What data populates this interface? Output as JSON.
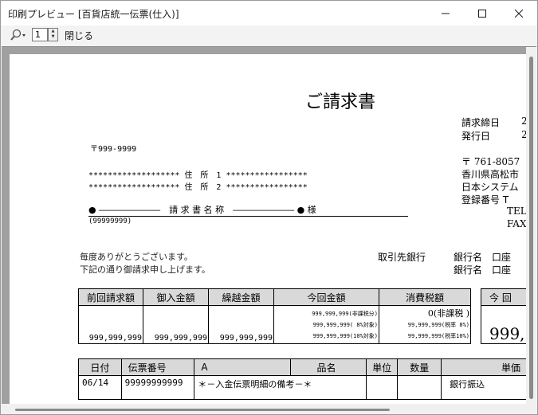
{
  "window": {
    "title": "印刷プレビュー [百貨店統一伝票(仕入)]"
  },
  "toolbar": {
    "page_value": "1",
    "close_label": "閉じる",
    "zoom_icon": "magnifier-icon"
  },
  "document": {
    "title": "ご請求書",
    "closing_date_label": "請求締日",
    "closing_date_value": "2",
    "issue_date_label": "発行日",
    "issue_date_value": "2",
    "postal": "〒999-9999",
    "address1": "******************* 住　所　1 *****************",
    "address2": "******************* 住　所　2 *****************",
    "invoice_name_line": "● ―――――――　請 求 書 名 称　――――――― ● 様",
    "customer_code": "(99999999)",
    "greeting1": "毎度ありがとうございます。",
    "greeting2": "下記の通り御請求申し上げます。",
    "sender_postal": "〒 761-8057",
    "sender_address": "香川県高松市",
    "sender_company": "日本システム",
    "sender_regno": "登録番号 T",
    "tel": "TEL",
    "fax": "FAX",
    "bank_label": "取引先銀行",
    "bank_name1": "銀行名　口座",
    "bank_name2": "銀行名　口座"
  },
  "summary": {
    "headers": [
      "前回請求額",
      "御入金額",
      "繰越金額",
      "今回金額",
      "消費税額",
      "今 回"
    ],
    "prev": "999,999,999",
    "paid": "999,999,999",
    "carry": "999,999,999",
    "current_lines": [
      "999,999,999(非課税分)",
      "999,999,999( 8%対象)",
      "999,999,999(10%対象)"
    ],
    "tax_lines": [
      "0(非課税 )",
      "99,999,999(税率 8%)",
      "99,999,999(税率10%)"
    ],
    "total_partial": "999,"
  },
  "detail": {
    "headers": [
      "日付",
      "伝票番号",
      "A",
      "品名",
      "単位",
      "数量",
      "単価"
    ],
    "row": {
      "date": "06/14",
      "slip_no": "99999999999",
      "item": "＊－入金伝票明細の備考－＊",
      "price": "銀行振込"
    }
  }
}
